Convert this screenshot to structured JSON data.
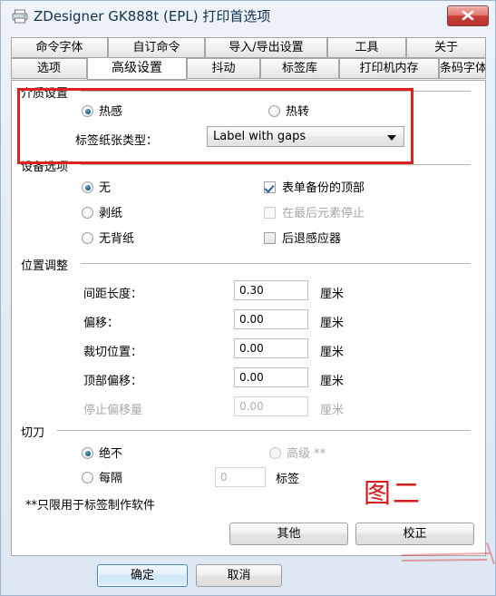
{
  "window": {
    "title": "ZDesigner GK888t (EPL) 打印首选项",
    "icon": "printer-icon",
    "close_label": "✕"
  },
  "tabs": {
    "row1": [
      {
        "label": "命令字体",
        "active": false
      },
      {
        "label": "自订命令",
        "active": false
      },
      {
        "label": "导入/导出设置",
        "active": false
      },
      {
        "label": "工具",
        "active": false
      },
      {
        "label": "关于",
        "active": false
      }
    ],
    "row2": [
      {
        "label": "选项",
        "active": false
      },
      {
        "label": "高级设置",
        "active": true
      },
      {
        "label": "抖动",
        "active": false
      },
      {
        "label": "标签库",
        "active": false
      },
      {
        "label": "打印机内存",
        "active": false
      },
      {
        "label": "条码字体",
        "active": false
      }
    ]
  },
  "media_settings": {
    "group_title": "介质设置",
    "radio_thermal_direct": "热感",
    "radio_thermal_transfer": "热转",
    "paper_type_label": "标签纸张类型：",
    "paper_type_value": "Label with gaps"
  },
  "device_options": {
    "group_title": "设备选项",
    "radio_none": "无",
    "radio_peel": "剥纸",
    "radio_linerless": "无背纸",
    "check_form_backup_top": "表单备份的顶部",
    "check_stop_at_last": "在最后元素停止",
    "check_backfeed_sensor": "后退感应器"
  },
  "position_adjust": {
    "group_title": "位置调整",
    "rows": [
      {
        "label": "间距长度：",
        "value": "0.30",
        "unit": "厘米",
        "disabled": false
      },
      {
        "label": "偏移：",
        "value": "0.00",
        "unit": "厘米",
        "disabled": false
      },
      {
        "label": "裁切位置：",
        "value": "0.00",
        "unit": "厘米",
        "disabled": false
      },
      {
        "label": "顶部偏移：",
        "value": "0.00",
        "unit": "厘米",
        "disabled": false
      },
      {
        "label": "停止偏移量",
        "value": "0.00",
        "unit": "厘米",
        "disabled": true
      }
    ]
  },
  "cutter": {
    "group_title": "切刀",
    "radio_never": "绝不",
    "radio_advanced": "高级 **",
    "radio_every": "每隔",
    "every_value": "0",
    "every_unit": "标签",
    "footnote": "**只限用于标签制作软件"
  },
  "page_buttons": {
    "other": "其他",
    "calibrate": "校正"
  },
  "dialog_buttons": {
    "ok": "确定",
    "cancel": "取消"
  },
  "annotation": {
    "text": "图二",
    "color": "#d41b1b"
  },
  "colors": {
    "accent": "#2a6f93",
    "annotation_red": "#e02020",
    "close_red": "#c9413a",
    "title_text": "#11304e"
  }
}
